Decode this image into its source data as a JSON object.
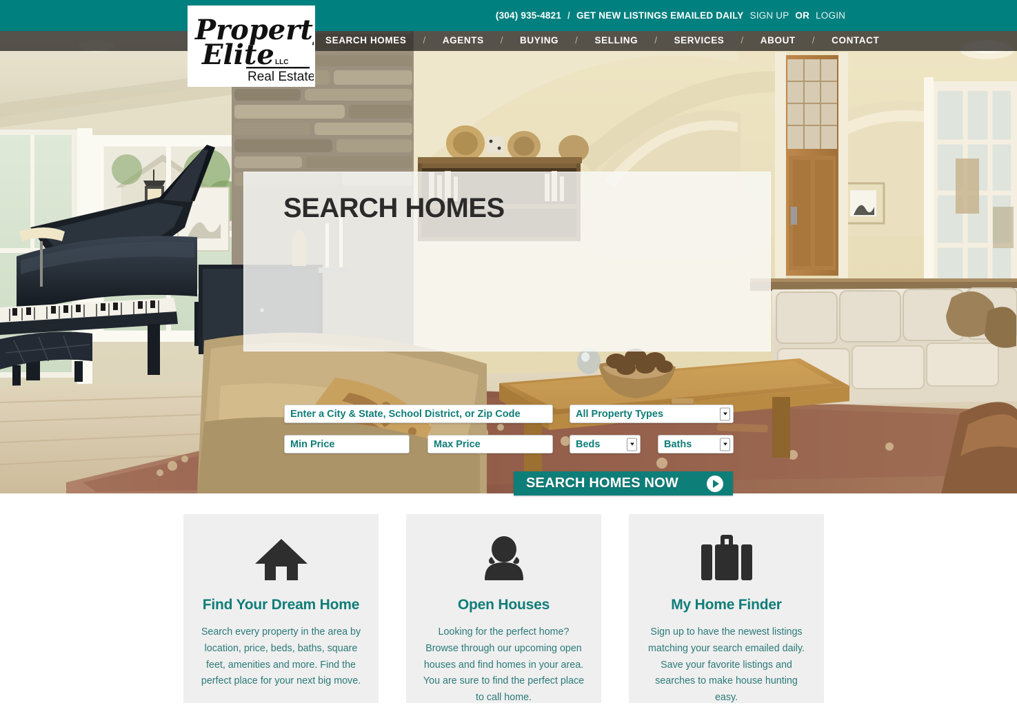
{
  "colors": {
    "teal": "#00807f",
    "teal_text": "#0f7d78",
    "nav_bg": "rgba(48,45,41,0.80)",
    "card_bg": "#efefef",
    "card_text": "#2a7a78"
  },
  "topbar": {
    "phone": "(304) 935-4821",
    "separator": "/",
    "emailed_daily": "GET NEW LISTINGS EMAILED DAILY",
    "sign_up": "SIGN UP",
    "or": "OR",
    "login": "LOGIN"
  },
  "logo": {
    "line1": "Property",
    "line2": "Elite",
    "suffix": "LLC",
    "line3": "Real Estate"
  },
  "nav": {
    "divider": "/",
    "items": [
      {
        "label": "SEARCH HOMES"
      },
      {
        "label": "AGENTS"
      },
      {
        "label": "BUYING"
      },
      {
        "label": "SELLING"
      },
      {
        "label": "SERVICES"
      },
      {
        "label": "ABOUT"
      },
      {
        "label": "CONTACT"
      }
    ]
  },
  "search": {
    "title": "SEARCH HOMES",
    "location_placeholder": "Enter a City & State, School District, or Zip Code",
    "property_type_value": "All Property Types",
    "min_price_placeholder": "Min Price",
    "max_price_placeholder": "Max Price",
    "beds_value": "Beds",
    "baths_value": "Baths",
    "submit_label": "SEARCH HOMES NOW"
  },
  "cards": [
    {
      "icon": "home-icon",
      "heading": "Find Your Dream Home",
      "body": "Search every property in the area by location, price, beds, baths, square feet, amenities and more. Find the perfect place for your next big move."
    },
    {
      "icon": "person-icon",
      "heading": "Open Houses",
      "body": "Looking for the perfect home? Browse through our upcoming open houses and find homes in your area. You are sure to find the perfect place to call home."
    },
    {
      "icon": "briefcase-icon",
      "heading": "My Home Finder",
      "body": "Sign up to have the newest listings matching your search emailed daily. Save your favorite listings and searches to make house hunting easy."
    }
  ]
}
